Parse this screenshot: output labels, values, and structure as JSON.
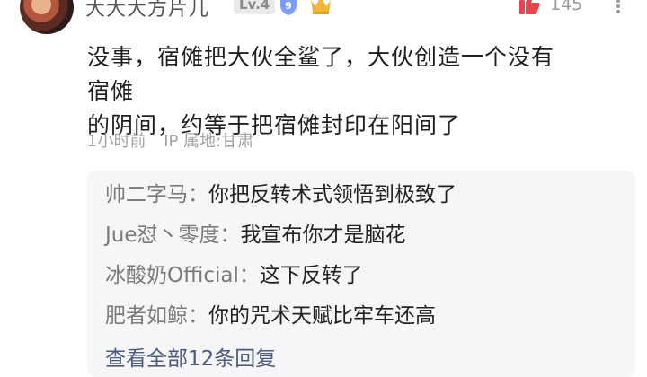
{
  "comment": {
    "username": "大大大方片儿",
    "level": "Lv.4",
    "likes": "145",
    "text_line1": "没事，宿傩把大伙全鲨了，大伙创造一个没有宿傩",
    "text_line2": "的阴间，约等于把宿傩封印在阳间了",
    "time": "1小时前",
    "ip": "IP 属地:甘肃"
  },
  "replies": [
    {
      "author": "帅二字马",
      "sep": "：",
      "text": "你把反转术式领悟到极致了"
    },
    {
      "author": "Jue怼丶零度",
      "sep": "：",
      "text": "我宣布你才是脑花"
    },
    {
      "author": "冰酸奶Official",
      "sep": "：",
      "text": "这下反转了"
    },
    {
      "author": "肥者如鲸",
      "sep": "：",
      "text": "你的咒术天赋比牢车还高"
    }
  ],
  "view_all": "查看全部12条回复",
  "icons": {
    "like": "like-icon",
    "more": "more-icon",
    "shield": "verified-shield-icon",
    "crown": "crown-badge-icon"
  },
  "colors": {
    "shield": "#7b9cff",
    "crown": "#f4b63a",
    "like": "#e8464c"
  }
}
